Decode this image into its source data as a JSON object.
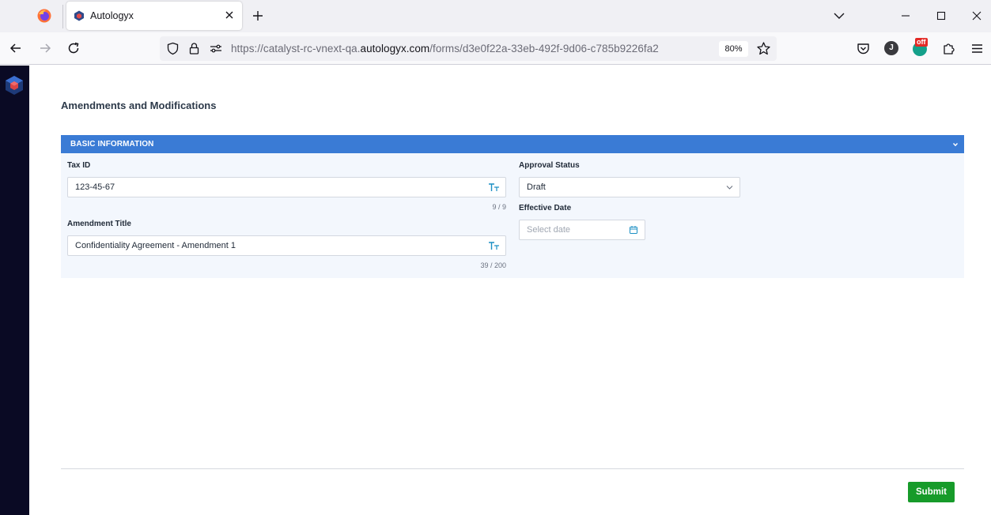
{
  "browser": {
    "tab_title": "Autologyx",
    "url_prefix": "https://catalyst-rc-vnext-qa.",
    "url_domain": "autologyx.com",
    "url_path": "/forms/d3e0f22a-33eb-492f-9d06-c785b9226fa2",
    "zoom": "80%",
    "account_initial": "J",
    "extension_badge": "off"
  },
  "page": {
    "title": "Amendments and Modifications"
  },
  "section": {
    "title": "BASIC INFORMATION"
  },
  "fields": {
    "tax_id": {
      "label": "Tax ID",
      "value": "123-45-67",
      "counter": "9 / 9"
    },
    "amendment_title": {
      "label": "Amendment Title",
      "value": "Confidentiality Agreement - Amendment 1",
      "counter": "39 / 200"
    },
    "approval_status": {
      "label": "Approval Status",
      "value": "Draft"
    },
    "effective_date": {
      "label": "Effective Date",
      "placeholder": "Select date"
    }
  },
  "actions": {
    "submit_label": "Submit"
  },
  "colors": {
    "section_header": "#3a7bd5",
    "submit": "#179b2a",
    "sidebar": "#0a0a24"
  }
}
